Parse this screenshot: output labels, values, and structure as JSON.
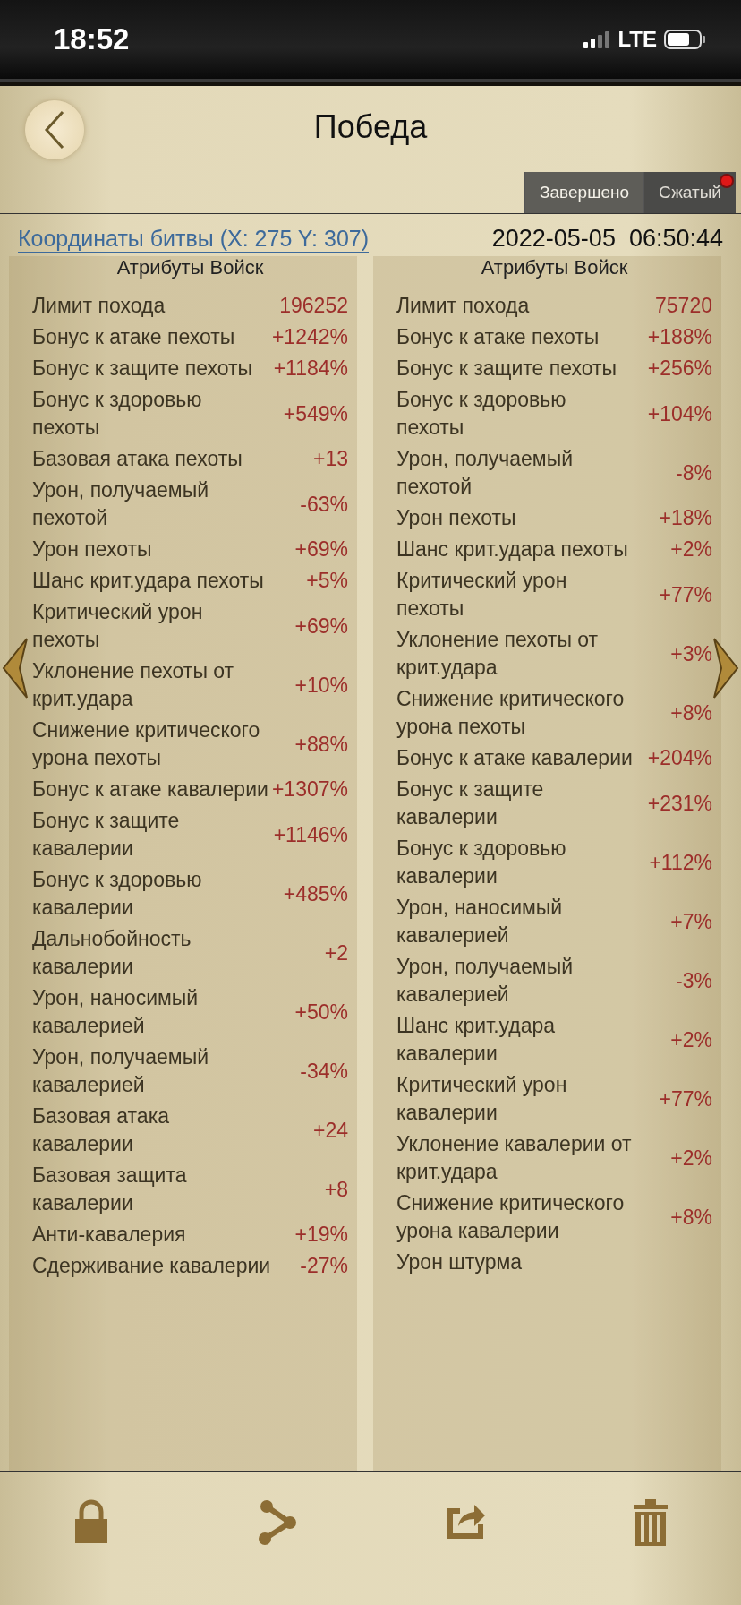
{
  "status_bar": {
    "time": "18:52",
    "network": "LTE"
  },
  "header": {
    "title": "Победа"
  },
  "tabs": [
    {
      "label": "Завершено",
      "selected": true,
      "dot": false
    },
    {
      "label": "Сжатый",
      "selected": false,
      "dot": true
    }
  ],
  "battle": {
    "coordinates": "Координаты битвы (X: 275 Y: 307)",
    "datetime": "2022-05-05  06:50:44"
  },
  "columns": [
    {
      "heading": "Атрибуты Войск",
      "rows": [
        {
          "label": "Лимит похода",
          "value": "196252"
        },
        {
          "label": "Бонус к атаке пехоты",
          "value": "+1242%"
        },
        {
          "label": "Бонус к защите пехоты",
          "value": "+1184%"
        },
        {
          "label": "Бонус к здоровью пехоты",
          "value": "+549%"
        },
        {
          "label": "Базовая атака пехоты",
          "value": "+13"
        },
        {
          "label": "Урон, получаемый пехотой",
          "value": "-63%"
        },
        {
          "label": "Урон пехоты",
          "value": "+69%"
        },
        {
          "label": "Шанс крит.удара пехоты",
          "value": "+5%"
        },
        {
          "label": "Критический урон пехоты",
          "value": "+69%"
        },
        {
          "label": "Уклонение пехоты от крит.удара",
          "value": "+10%"
        },
        {
          "label": "Снижение критического урона пехоты",
          "value": "+88%"
        },
        {
          "label": "Бонус к атаке кавалерии",
          "value": "+1307%"
        },
        {
          "label": "Бонус к защите кавалерии",
          "value": "+1146%"
        },
        {
          "label": "Бонус к здоровью кавалерии",
          "value": "+485%"
        },
        {
          "label": "Дальнобойность кавалерии",
          "value": "+2"
        },
        {
          "label": "Урон, наносимый кавалерией",
          "value": "+50%"
        },
        {
          "label": "Урон, получаемый кавалерией",
          "value": "-34%"
        },
        {
          "label": "Базовая атака кавалерии",
          "value": "+24"
        },
        {
          "label": "Базовая защита кавалерии",
          "value": "+8"
        },
        {
          "label": "Анти-кавалерия",
          "value": "+19%"
        },
        {
          "label": "Сдерживание кавалерии",
          "value": "-27%"
        }
      ]
    },
    {
      "heading": "Атрибуты Войск",
      "rows": [
        {
          "label": "Лимит похода",
          "value": "75720"
        },
        {
          "label": "Бонус к атаке пехоты",
          "value": "+188%"
        },
        {
          "label": "Бонус к защите пехоты",
          "value": "+256%"
        },
        {
          "label": "Бонус к здоровью пехоты",
          "value": "+104%"
        },
        {
          "label": "Урон, получаемый пехотой",
          "value": "-8%"
        },
        {
          "label": "Урон пехоты",
          "value": "+18%"
        },
        {
          "label": "Шанс крит.удара пехоты",
          "value": "+2%"
        },
        {
          "label": "Критический урон пехоты",
          "value": "+77%"
        },
        {
          "label": "Уклонение пехоты от крит.удара",
          "value": "+3%"
        },
        {
          "label": "Снижение критического урона пехоты",
          "value": "+8%"
        },
        {
          "label": "Бонус к атаке кавалерии",
          "value": "+204%"
        },
        {
          "label": "Бонус к защите кавалерии",
          "value": "+231%"
        },
        {
          "label": "Бонус к здоровью кавалерии",
          "value": "+112%"
        },
        {
          "label": "Урон, наносимый кавалерией",
          "value": "+7%"
        },
        {
          "label": "Урон, получаемый кавалерией",
          "value": "-3%"
        },
        {
          "label": "Шанс крит.удара кавалерии",
          "value": "+2%"
        },
        {
          "label": "Критический урон кавалерии",
          "value": "+77%"
        },
        {
          "label": "Уклонение кавалерии от крит.удара",
          "value": "+2%"
        },
        {
          "label": "Снижение критического урона кавалерии",
          "value": "+8%"
        },
        {
          "label": "Урон штурма"
        }
      ]
    }
  ]
}
